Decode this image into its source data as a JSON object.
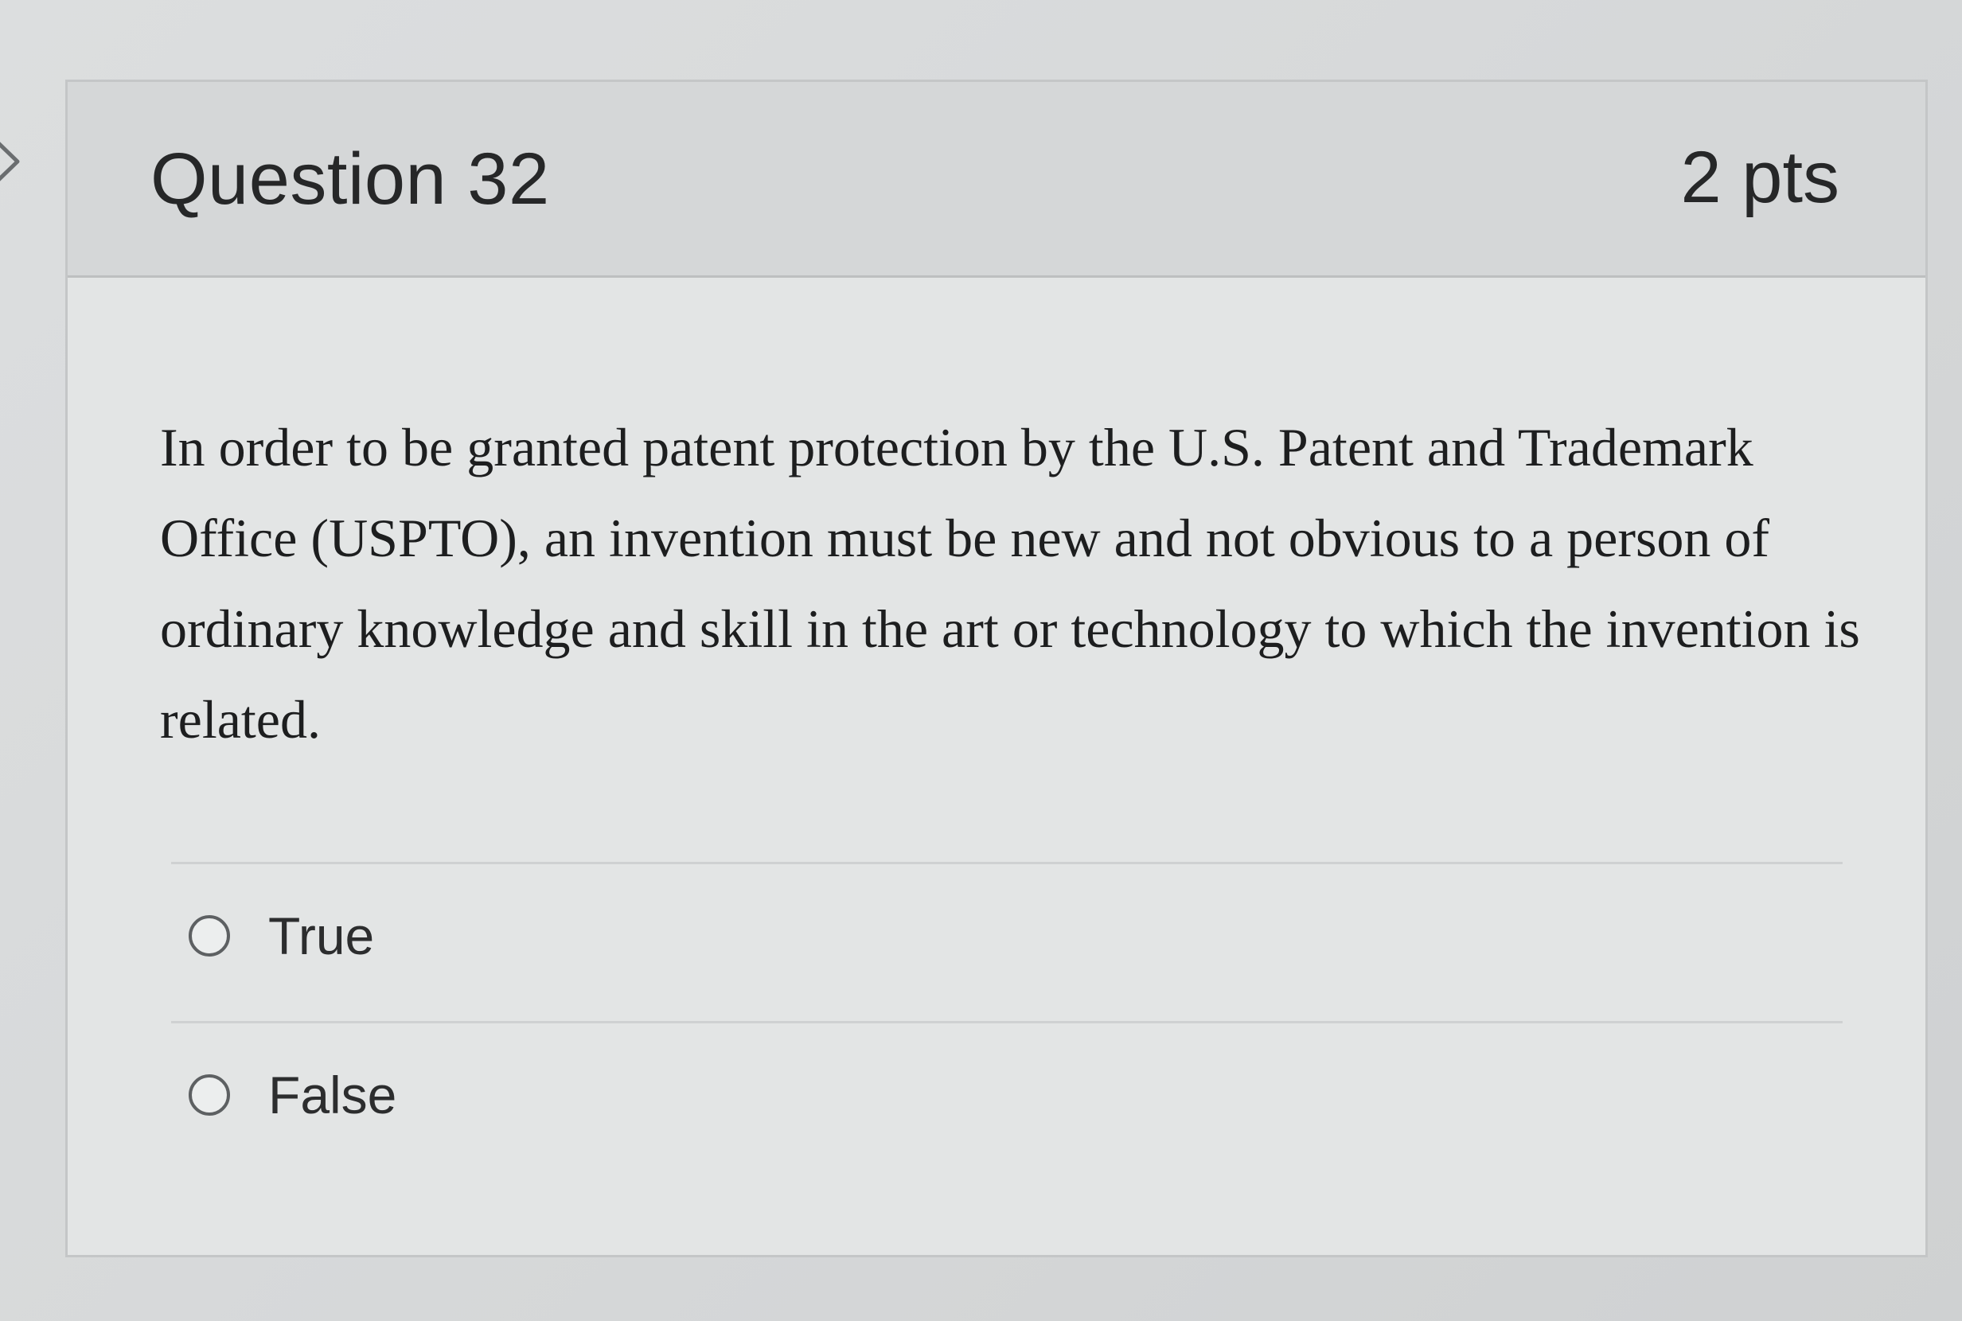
{
  "question": {
    "title": "Question 32",
    "points": "2 pts",
    "text": "In order to be granted patent protection by the U.S. Patent and Trademark Office (USPTO), an invention must be new and not obvious to a person of ordinary knowledge and skill in the art or technology to which the invention is related."
  },
  "answers": [
    {
      "label": "True",
      "selected": false
    },
    {
      "label": "False",
      "selected": false
    }
  ],
  "icons": {
    "nav": "chevron-right-icon",
    "option": "radio-icon"
  },
  "colors": {
    "header_bg": "#d5d7d8",
    "card_bg": "#e3e5e5",
    "text": "#262728"
  }
}
